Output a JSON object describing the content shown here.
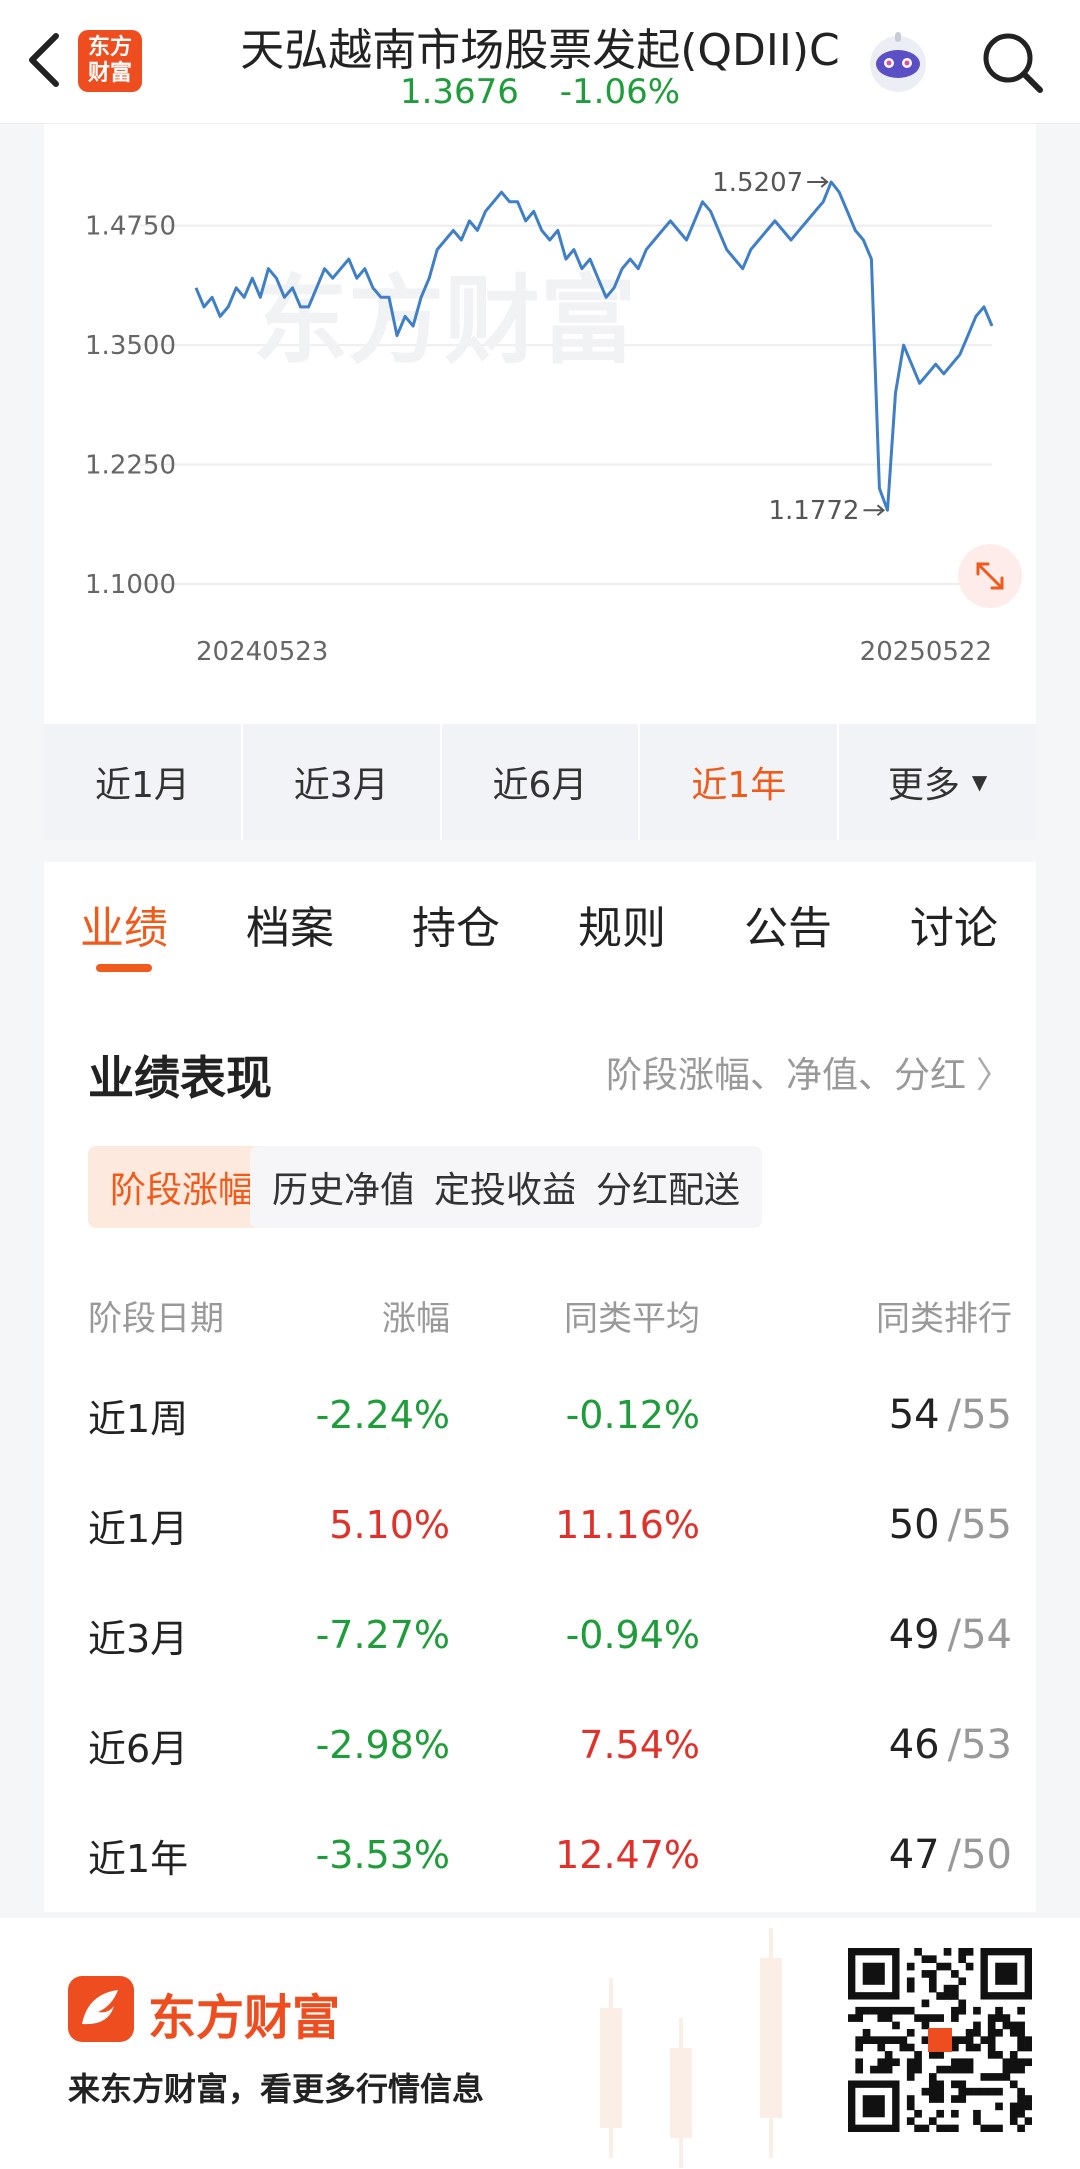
{
  "header": {
    "title": "天弘越南市场股票发起(QDII)C",
    "nav_value": "1.3676",
    "change": "-1.06%",
    "logo_line1": "东方",
    "logo_line2": "财富"
  },
  "chart": {
    "watermark": "东方财富",
    "high_label": "1.5207",
    "low_label": "1.1772",
    "start_date": "20240523",
    "end_date": "20250522"
  },
  "chart_data": {
    "type": "line",
    "title": "",
    "xlabel": "",
    "ylabel": "",
    "x_range": [
      "20240523",
      "20250522"
    ],
    "ylim": [
      1.1,
      1.55
    ],
    "yticks": [
      "1.4750",
      "1.3500",
      "1.2250",
      "1.1000"
    ],
    "grid": true,
    "annotations": [
      {
        "label": "1.5207",
        "value": 1.5207
      },
      {
        "label": "1.1772",
        "value": 1.1772
      }
    ],
    "series": [
      {
        "values": [
          1.41,
          1.39,
          1.4,
          1.38,
          1.39,
          1.41,
          1.4,
          1.42,
          1.4,
          1.43,
          1.42,
          1.4,
          1.41,
          1.39,
          1.39,
          1.41,
          1.43,
          1.42,
          1.43,
          1.44,
          1.42,
          1.43,
          1.41,
          1.4,
          1.4,
          1.36,
          1.38,
          1.37,
          1.4,
          1.42,
          1.45,
          1.46,
          1.47,
          1.46,
          1.48,
          1.47,
          1.49,
          1.5,
          1.51,
          1.5,
          1.5,
          1.48,
          1.49,
          1.47,
          1.46,
          1.47,
          1.44,
          1.45,
          1.43,
          1.44,
          1.42,
          1.4,
          1.41,
          1.43,
          1.44,
          1.43,
          1.45,
          1.46,
          1.47,
          1.48,
          1.47,
          1.46,
          1.48,
          1.5,
          1.49,
          1.47,
          1.45,
          1.44,
          1.43,
          1.45,
          1.46,
          1.47,
          1.48,
          1.47,
          1.46,
          1.47,
          1.48,
          1.49,
          1.5,
          1.5207,
          1.51,
          1.49,
          1.47,
          1.46,
          1.44,
          1.2,
          1.1772,
          1.3,
          1.35,
          1.33,
          1.31,
          1.32,
          1.33,
          1.32,
          1.33,
          1.34,
          1.36,
          1.38,
          1.39,
          1.37
        ]
      }
    ]
  },
  "periods": {
    "items": [
      {
        "label": "近1月"
      },
      {
        "label": "近3月"
      },
      {
        "label": "近6月"
      },
      {
        "label": "近1年"
      },
      {
        "label": "更多"
      }
    ],
    "active_index": 3
  },
  "tabs": {
    "items": [
      {
        "label": "业绩"
      },
      {
        "label": "档案"
      },
      {
        "label": "持仓"
      },
      {
        "label": "规则"
      },
      {
        "label": "公告"
      },
      {
        "label": "讨论"
      }
    ],
    "active_index": 0
  },
  "performance": {
    "title": "业绩表现",
    "link": "阶段涨幅、净值、分红",
    "sub_tabs": [
      {
        "label": "阶段涨幅"
      },
      {
        "label": "历史净值"
      },
      {
        "label": "定投收益"
      },
      {
        "label": "分红配送"
      }
    ],
    "columns": [
      "阶段日期",
      "涨幅",
      "同类平均",
      "同类排行"
    ],
    "rows": [
      {
        "period": "近1周",
        "change": "-2.24%",
        "avg": "-0.12%",
        "rank": "54",
        "total": "/55"
      },
      {
        "period": "近1月",
        "change": "5.10%",
        "avg": "11.16%",
        "rank": "50",
        "total": "/55"
      },
      {
        "period": "近3月",
        "change": "-7.27%",
        "avg": "-0.94%",
        "rank": "49",
        "total": "/54"
      },
      {
        "period": "近6月",
        "change": "-2.98%",
        "avg": "7.54%",
        "rank": "46",
        "total": "/53"
      },
      {
        "period": "近1年",
        "change": "-3.53%",
        "avg": "12.47%",
        "rank": "47",
        "total": "/50"
      }
    ]
  },
  "footer": {
    "brand": "东方财富",
    "slogan": "来东方财富，看更多行情信息"
  },
  "colors": {
    "accent": "#f05a1a",
    "up": "#e0322b",
    "down": "#1f9d3a",
    "line": "#3f7fc7"
  }
}
